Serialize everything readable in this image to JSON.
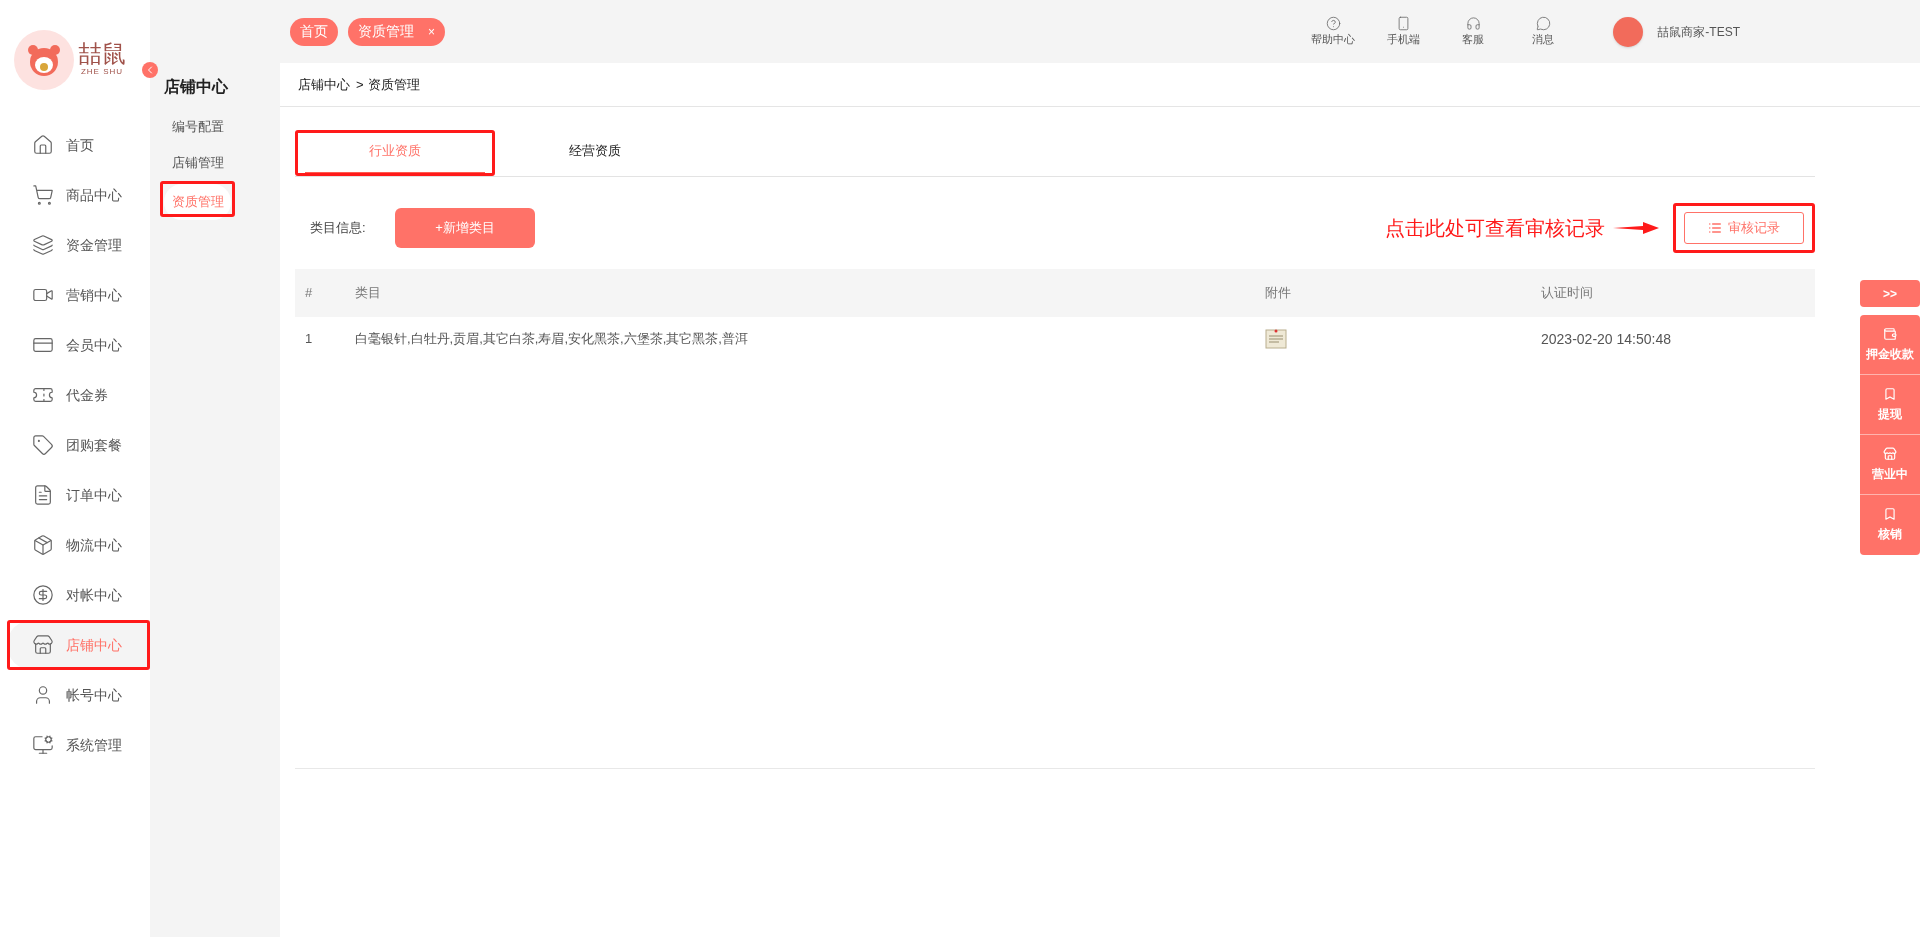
{
  "brand": {
    "name": "喆鼠",
    "latin": "ZHE SHU"
  },
  "sidebar": {
    "items": [
      {
        "label": "首页",
        "selected": false,
        "highlighted": false
      },
      {
        "label": "商品中心",
        "selected": false,
        "highlighted": false
      },
      {
        "label": "资金管理",
        "selected": false,
        "highlighted": false
      },
      {
        "label": "营销中心",
        "selected": false,
        "highlighted": false
      },
      {
        "label": "会员中心",
        "selected": false,
        "highlighted": false
      },
      {
        "label": "代金券",
        "selected": false,
        "highlighted": false
      },
      {
        "label": "团购套餐",
        "selected": false,
        "highlighted": false
      },
      {
        "label": "订单中心",
        "selected": false,
        "highlighted": false
      },
      {
        "label": "物流中心",
        "selected": false,
        "highlighted": false
      },
      {
        "label": "对帐中心",
        "selected": false,
        "highlighted": false
      },
      {
        "label": "店铺中心",
        "selected": true,
        "highlighted": true
      },
      {
        "label": "帐号中心",
        "selected": false,
        "highlighted": false
      },
      {
        "label": "系统管理",
        "selected": false,
        "highlighted": false
      }
    ]
  },
  "subnav": {
    "title": "店铺中心",
    "items": [
      {
        "label": "编号配置",
        "selected": false,
        "highlighted": false
      },
      {
        "label": "店铺管理",
        "selected": false,
        "highlighted": false
      },
      {
        "label": "资质管理",
        "selected": true,
        "highlighted": true
      }
    ]
  },
  "open_tabs": [
    {
      "label": "首页",
      "closable": false
    },
    {
      "label": "资质管理",
      "closable": true
    }
  ],
  "open_tab_close": "×",
  "toolbar": [
    {
      "label": "帮助中心"
    },
    {
      "label": "手机端"
    },
    {
      "label": "客服"
    },
    {
      "label": "消息"
    }
  ],
  "user": {
    "name": "喆鼠商家-TEST"
  },
  "breadcrumb": {
    "items": [
      "店铺中心",
      "资质管理"
    ],
    "separator": ">"
  },
  "tabs": [
    {
      "label": "行业资质",
      "selected": true,
      "highlighted": true
    },
    {
      "label": "经营资质",
      "selected": false,
      "highlighted": false
    }
  ],
  "category_label": "类目信息:",
  "add_button": "+新增类目",
  "callout": "点击此处可查看审核记录",
  "audit_button": {
    "label": "审核记录",
    "highlighted": true
  },
  "table": {
    "columns": [
      "#",
      "类目",
      "附件",
      "认证时间"
    ],
    "rows": [
      {
        "index": "1",
        "category": "白毫银针,白牡丹,贡眉,其它白茶,寿眉,安化黑茶,六堡茶,其它黑茶,普洱",
        "has_attachment": true,
        "time": "2023-02-20 14:50:48"
      }
    ]
  },
  "float_panel": {
    "toggle": ">>",
    "items": [
      {
        "label": "押金收款"
      },
      {
        "label": "提现"
      },
      {
        "label": "营业中"
      },
      {
        "label": "核销"
      }
    ]
  }
}
